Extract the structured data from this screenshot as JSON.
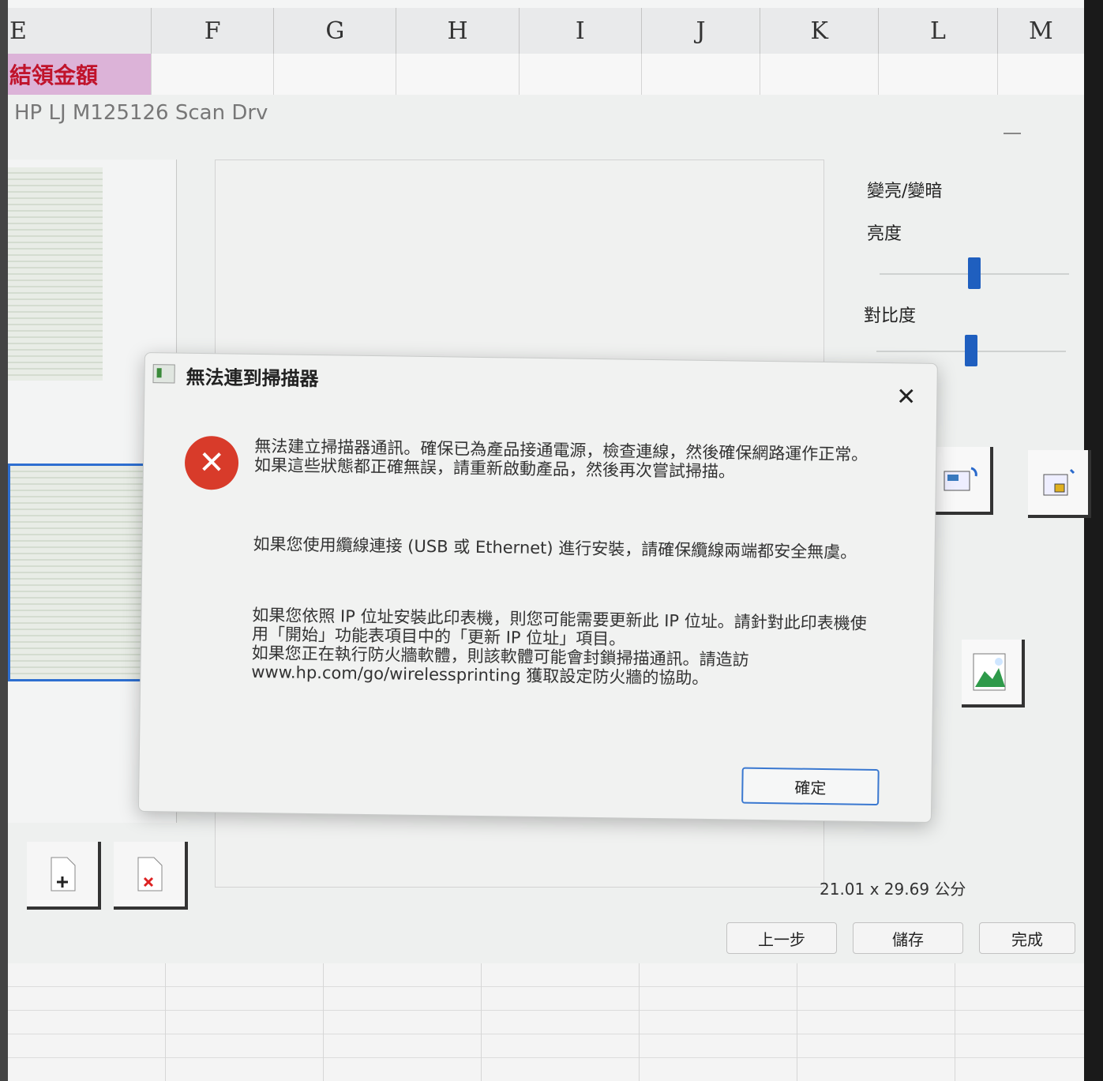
{
  "spreadsheet": {
    "columns": [
      "E",
      "F",
      "G",
      "H",
      "I",
      "J",
      "K",
      "L",
      "M"
    ],
    "cell_pink_text": "結領金額"
  },
  "scan_app": {
    "title": "HP LJ M125126 Scan Drv",
    "brightness_group_label": "變亮/變暗",
    "brightness_label": "亮度",
    "contrast_label": "對比度",
    "size_label": "21.01 x 29.69 公分",
    "back_button": "上一步",
    "save_button": "儲存",
    "finish_button": "完成",
    "brightness_level": 0.5,
    "contrast_level": 0.5
  },
  "dialog": {
    "title": "無法連到掃描器",
    "message1": "無法建立掃描器通訊。確保已為產品接通電源，檢查連線，然後確保網路運作正常。如果這些狀態都正確無誤，請重新啟動產品，然後再次嘗試掃描。",
    "message2": "如果您使用纜線連接 (USB 或 Ethernet) 進行安裝，請確保纜線兩端都安全無虞。",
    "message3a": "如果您依照 IP 位址安裝此印表機，則您可能需要更新此 IP 位址。請針對此印表機使用「開始」功能表項目中的「更新 IP 位址」項目。",
    "message3b": "如果您正在執行防火牆軟體，則該軟體可能會封鎖掃描通訊。請造訪 www.hp.com/go/wirelessprinting 獲取設定防火牆的協助。",
    "ok_button": "確定",
    "close_glyph": "✕",
    "error_glyph": "✕"
  },
  "colors": {
    "error_red": "#d83b2a",
    "accent_blue": "#1f5fbf",
    "header_pink": "#dcb3d8"
  }
}
